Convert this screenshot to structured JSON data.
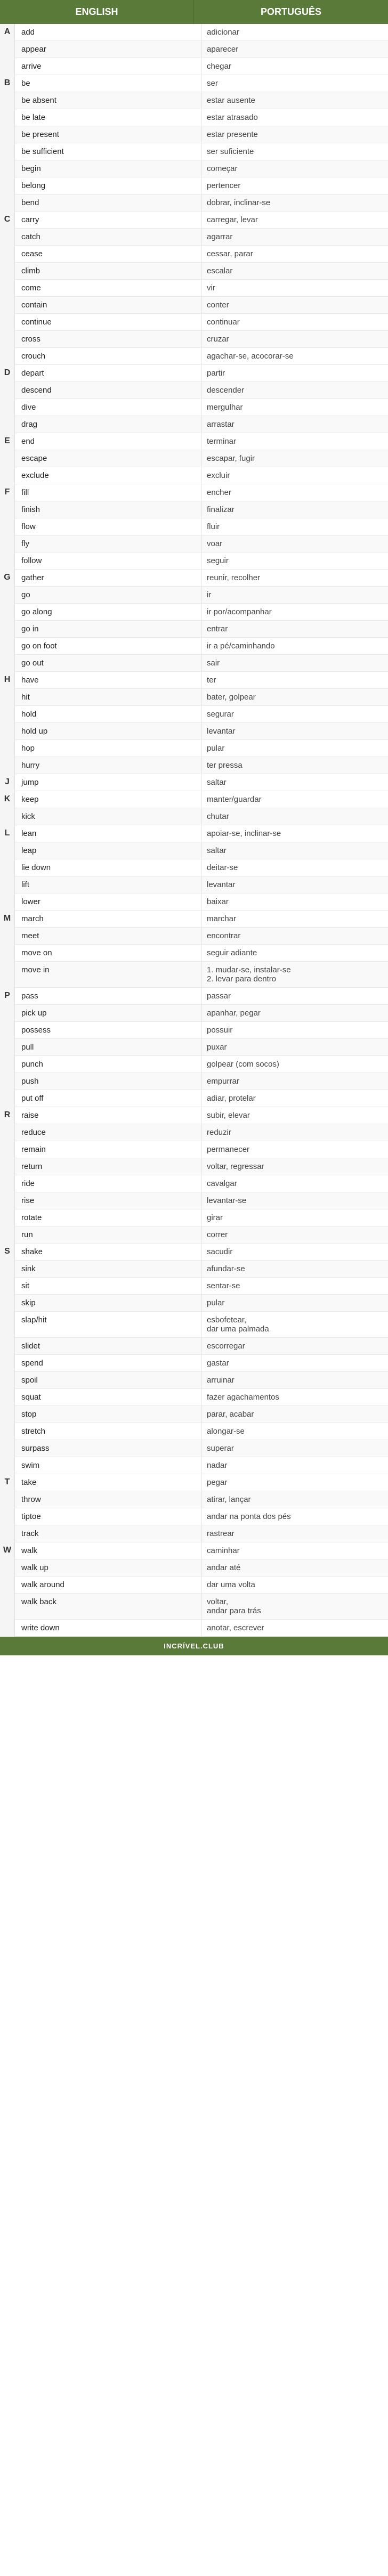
{
  "header": {
    "col_en": "ENGLISH",
    "col_pt": "PORTUGUÊS"
  },
  "footer": {
    "text": "INCRÍVEL.CLUB"
  },
  "sections": [
    {
      "letter": "A",
      "words": [
        {
          "en": "add",
          "pt": "adicionar"
        },
        {
          "en": "appear",
          "pt": "aparecer"
        },
        {
          "en": "arrive",
          "pt": "chegar"
        }
      ]
    },
    {
      "letter": "B",
      "words": [
        {
          "en": "be",
          "pt": "ser"
        },
        {
          "en": "be absent",
          "pt": "estar ausente"
        },
        {
          "en": "be late",
          "pt": "estar atrasado"
        },
        {
          "en": "be present",
          "pt": "estar presente"
        },
        {
          "en": "be sufficient",
          "pt": "ser suficiente"
        },
        {
          "en": "begin",
          "pt": "começar"
        },
        {
          "en": "belong",
          "pt": "pertencer"
        },
        {
          "en": "bend",
          "pt": "dobrar, inclinar-se"
        }
      ]
    },
    {
      "letter": "C",
      "words": [
        {
          "en": "carry",
          "pt": "carregar, levar"
        },
        {
          "en": "catch",
          "pt": "agarrar"
        },
        {
          "en": "cease",
          "pt": "cessar, parar"
        },
        {
          "en": "climb",
          "pt": "escalar"
        },
        {
          "en": "come",
          "pt": "vir"
        },
        {
          "en": "contain",
          "pt": "conter"
        },
        {
          "en": "continue",
          "pt": "continuar"
        },
        {
          "en": "cross",
          "pt": "cruzar"
        },
        {
          "en": "crouch",
          "pt": "agachar-se, acocorar-se"
        }
      ]
    },
    {
      "letter": "D",
      "words": [
        {
          "en": "depart",
          "pt": "partir"
        },
        {
          "en": "descend",
          "pt": "descender"
        },
        {
          "en": "dive",
          "pt": "mergulhar"
        },
        {
          "en": "drag",
          "pt": "arrastar"
        }
      ]
    },
    {
      "letter": "E",
      "words": [
        {
          "en": "end",
          "pt": "terminar"
        },
        {
          "en": "escape",
          "pt": "escapar, fugir"
        },
        {
          "en": "exclude",
          "pt": "excluir"
        }
      ]
    },
    {
      "letter": "F",
      "words": [
        {
          "en": "fill",
          "pt": "encher"
        },
        {
          "en": "finish",
          "pt": "finalizar"
        },
        {
          "en": "flow",
          "pt": "fluir"
        },
        {
          "en": "fly",
          "pt": "voar"
        },
        {
          "en": "follow",
          "pt": "seguir"
        }
      ]
    },
    {
      "letter": "G",
      "words": [
        {
          "en": "gather",
          "pt": "reunir, recolher"
        },
        {
          "en": "go",
          "pt": "ir"
        },
        {
          "en": "go along",
          "pt": "ir por/acompanhar"
        },
        {
          "en": "go in",
          "pt": "entrar"
        },
        {
          "en": "go on foot",
          "pt": "ir a pé/caminhando"
        },
        {
          "en": "go out",
          "pt": "sair"
        }
      ]
    },
    {
      "letter": "H",
      "words": [
        {
          "en": "have",
          "pt": "ter"
        },
        {
          "en": "hit",
          "pt": "bater, golpear"
        },
        {
          "en": "hold",
          "pt": "segurar"
        },
        {
          "en": "hold up",
          "pt": "levantar"
        },
        {
          "en": "hop",
          "pt": "pular"
        },
        {
          "en": "hurry",
          "pt": "ter pressa"
        }
      ]
    },
    {
      "letter": "J",
      "words": [
        {
          "en": "jump",
          "pt": "saltar"
        }
      ]
    },
    {
      "letter": "K",
      "words": [
        {
          "en": "keep",
          "pt": "manter/guardar"
        },
        {
          "en": "kick",
          "pt": "chutar"
        }
      ]
    },
    {
      "letter": "L",
      "words": [
        {
          "en": "lean",
          "pt": "apoiar-se, inclinar-se"
        },
        {
          "en": "leap",
          "pt": "saltar"
        },
        {
          "en": "lie down",
          "pt": "deitar-se"
        },
        {
          "en": "lift",
          "pt": "levantar"
        },
        {
          "en": "lower",
          "pt": "baixar"
        }
      ]
    },
    {
      "letter": "M",
      "words": [
        {
          "en": "march",
          "pt": "marchar"
        },
        {
          "en": "meet",
          "pt": "encontrar"
        },
        {
          "en": "move on",
          "pt": "seguir adiante"
        },
        {
          "en": "move in",
          "pt": "1. mudar-se, instalar-se\n2. levar para dentro"
        }
      ]
    },
    {
      "letter": "P",
      "words": [
        {
          "en": "pass",
          "pt": "passar"
        },
        {
          "en": "pick up",
          "pt": "apanhar, pegar"
        },
        {
          "en": "possess",
          "pt": "possuir"
        },
        {
          "en": "pull",
          "pt": "puxar"
        },
        {
          "en": "punch",
          "pt": "golpear (com socos)"
        },
        {
          "en": "push",
          "pt": "empurrar"
        },
        {
          "en": "put off",
          "pt": "adiar, protelar"
        }
      ]
    },
    {
      "letter": "R",
      "words": [
        {
          "en": "raise",
          "pt": "subir, elevar"
        },
        {
          "en": "reduce",
          "pt": "reduzir"
        },
        {
          "en": "remain",
          "pt": "permanecer"
        },
        {
          "en": "return",
          "pt": "voltar, regressar"
        },
        {
          "en": "ride",
          "pt": "cavalgar"
        },
        {
          "en": "rise",
          "pt": "levantar-se"
        },
        {
          "en": "rotate",
          "pt": "girar"
        },
        {
          "en": "run",
          "pt": "correr"
        }
      ]
    },
    {
      "letter": "S",
      "words": [
        {
          "en": "shake",
          "pt": "sacudir"
        },
        {
          "en": "sink",
          "pt": "afundar-se"
        },
        {
          "en": "sit",
          "pt": "sentar-se"
        },
        {
          "en": "skip",
          "pt": "pular"
        },
        {
          "en": "slap/hit",
          "pt": "esbofetear,\ndar uma palmada"
        },
        {
          "en": "slidet",
          "pt": "escorregar"
        },
        {
          "en": "spend",
          "pt": "gastar"
        },
        {
          "en": "spoil",
          "pt": "arruinar"
        },
        {
          "en": "squat",
          "pt": "fazer agachamentos"
        },
        {
          "en": "stop",
          "pt": "parar, acabar"
        },
        {
          "en": "stretch",
          "pt": "alongar-se"
        },
        {
          "en": "surpass",
          "pt": "superar"
        },
        {
          "en": "swim",
          "pt": "nadar"
        }
      ]
    },
    {
      "letter": "T",
      "words": [
        {
          "en": "take",
          "pt": "pegar"
        },
        {
          "en": "throw",
          "pt": "atirar, lançar"
        },
        {
          "en": "tiptoe",
          "pt": "andar na ponta dos pés"
        },
        {
          "en": "track",
          "pt": "rastrear"
        }
      ]
    },
    {
      "letter": "W",
      "words": [
        {
          "en": "walk",
          "pt": "caminhar"
        },
        {
          "en": "walk up",
          "pt": "andar até"
        },
        {
          "en": "walk around",
          "pt": "dar uma volta"
        },
        {
          "en": "walk back",
          "pt": "voltar,\nandar para trás"
        },
        {
          "en": "write down",
          "pt": "anotar, escrever"
        }
      ]
    }
  ]
}
